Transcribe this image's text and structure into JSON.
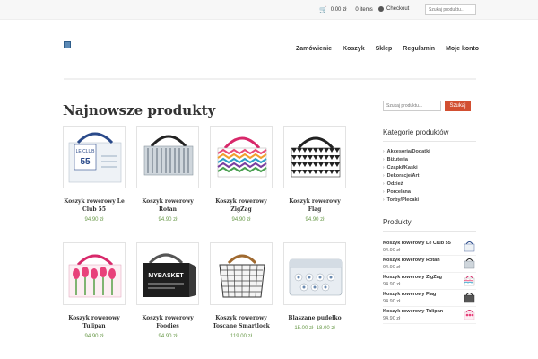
{
  "topbar": {
    "cart_amount": "0.00 zł",
    "cart_items": "0 items",
    "checkout_label": "Checkout",
    "search_placeholder": "Szukaj produktu..."
  },
  "nav": {
    "items": [
      "Zamówienie",
      "Koszyk",
      "Sklep",
      "Regulamin",
      "Moje konto"
    ]
  },
  "main": {
    "title": "Najnowsze produkty",
    "products": [
      {
        "name": "Koszyk rowerowy Le Club 55",
        "price": "94.90 zł"
      },
      {
        "name": "Koszyk rowerowy Rotan",
        "price": "94.90 zł"
      },
      {
        "name": "Koszyk rowerowy ZigZag",
        "price": "94.90 zł"
      },
      {
        "name": "Koszyk rowerowy Flag",
        "price": "94.90 zł"
      },
      {
        "name": "Koszyk rowerowy Tulipan",
        "price": "94.90 zł"
      },
      {
        "name": "Koszyk rowerowy Foodies",
        "price": "94.90 zł"
      },
      {
        "name": "Koszyk rowerowy Toscane Smartlock",
        "price": "119.00 zł"
      },
      {
        "name": "Blaszane pudełko",
        "price": "15.00 zł–18.00 zł"
      }
    ]
  },
  "sidebar": {
    "search_placeholder": "Szukaj produktu...",
    "search_button": "Szukaj",
    "categories_heading": "Kategorie produktów",
    "categories": [
      "Akcesoria/Dodatki",
      "Biżuteria",
      "Czapki/Kaski",
      "Dekoracje/Art",
      "Odzież",
      "Porcelana",
      "Torby/Plecaki"
    ],
    "products_heading": "Produkty",
    "products": [
      {
        "name": "Koszyk rowerowy Le Club 55",
        "price": "94.90 zł"
      },
      {
        "name": "Koszyk rowerowy Rotan",
        "price": "94.90 zł"
      },
      {
        "name": "Koszyk rowerowy ZigZag",
        "price": "94.90 zł"
      },
      {
        "name": "Koszyk rowerowy Flag",
        "price": "94.90 zł"
      },
      {
        "name": "Koszyk rowerowy Tulipan",
        "price": "94.90 zł"
      }
    ]
  },
  "colors": {
    "price_green": "#6a9a4a",
    "search_button_red": "#d24f31"
  },
  "thumb_labels": {
    "le_club": "LE CLUB",
    "le_club_num": "55",
    "mybasket": "MYBASKET"
  }
}
